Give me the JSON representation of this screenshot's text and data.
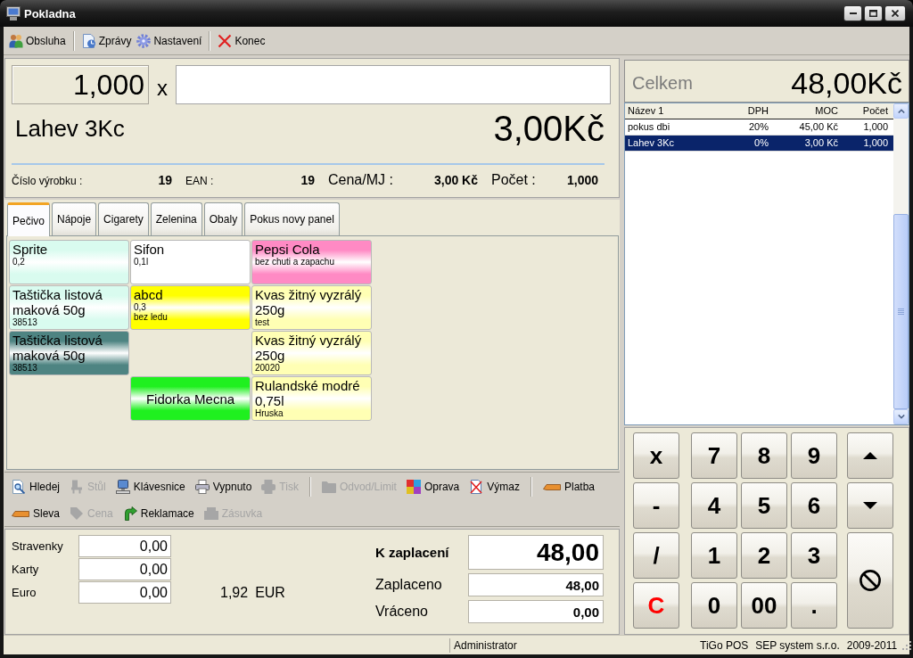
{
  "window": {
    "title": "Pokladna"
  },
  "toolbar": {
    "groups": [
      {
        "items": [
          {
            "label": "Obsluha"
          }
        ]
      },
      {
        "items": [
          {
            "label": "Zprávy"
          },
          {
            "label": "Nastavení"
          }
        ]
      },
      {
        "items": [
          {
            "label": "Konec"
          }
        ]
      }
    ]
  },
  "entry": {
    "quantity": "1,000",
    "times": "x"
  },
  "product": {
    "name": "Lahev 3Kc",
    "price": "3,00Kč",
    "details": [
      {
        "kind": "minor",
        "label": "Číslo výrobku :",
        "value": "19"
      },
      {
        "kind": "minor",
        "label": "EAN :",
        "value": "19"
      },
      {
        "kind": "major",
        "label": "Cena/MJ :",
        "value": "3,00 Kč"
      },
      {
        "kind": "major",
        "label": "Počet :",
        "value": "1,000"
      }
    ]
  },
  "tabs": [
    {
      "label": "Pečivo",
      "selected": true
    },
    {
      "label": "Nápoje",
      "selected": false
    },
    {
      "label": "Cigarety",
      "selected": false
    },
    {
      "label": "Zelenina",
      "selected": false
    },
    {
      "label": "Obaly",
      "selected": false
    },
    {
      "label": "Pokus novy panel",
      "selected": false
    }
  ],
  "tiles": {
    "rows": [
      {
        "cells": [
          {
            "kind": "product",
            "name": "Sprite",
            "notes": [
              "0,2"
            ],
            "color": "#d9fbef"
          },
          {
            "kind": "product",
            "name": "Sifon",
            "notes": [
              "0,1l"
            ],
            "color": "#ffffff"
          },
          {
            "kind": "product",
            "name": "Pepsi Cola",
            "notes": [
              "bez chuti a zapachu"
            ],
            "color": "#ff8ac4"
          }
        ]
      },
      {
        "cells": [
          {
            "kind": "product",
            "name": "Taštička listová maková 50g",
            "notes": [
              "38513"
            ],
            "color": "#d9fbef"
          },
          {
            "kind": "product",
            "name": "abcd",
            "notes": [
              "0,3",
              "bez ledu"
            ],
            "color": "#ffff00"
          },
          {
            "kind": "product",
            "name": "Kvas žitný vyzrálý 250g",
            "notes": [
              "test"
            ],
            "color": "#ffffb4"
          }
        ]
      },
      {
        "cells": [
          {
            "kind": "product",
            "name": "Taštička listová maková 50g",
            "notes": [
              "38513"
            ],
            "color": "#4e8482"
          },
          {
            "kind": "empty"
          },
          {
            "kind": "product",
            "name": "Kvas žitný vyzrálý 250g",
            "notes": [
              "20020"
            ],
            "color": "#ffffb4"
          }
        ]
      },
      {
        "cells": [
          {
            "kind": "empty"
          },
          {
            "kind": "product",
            "name": "Fidorka Mecna",
            "color": "#1ff01f"
          },
          {
            "kind": "product",
            "name": "Rulandské modré 0,75l",
            "notes": [
              "Hruska"
            ],
            "color": "#ffffb4"
          }
        ]
      }
    ]
  },
  "action_bar": {
    "rows": [
      {
        "groups": [
          {
            "items": [
              {
                "label": "Hledej",
                "disabled": false
              },
              {
                "label": "Stůl",
                "disabled": true
              },
              {
                "label": "Klávesnice",
                "disabled": false
              },
              {
                "label": "Vypnuto",
                "disabled": false
              },
              {
                "label": "Tisk",
                "disabled": true
              }
            ]
          },
          {
            "items": [
              {
                "label": "Odvod/Limit",
                "disabled": true
              },
              {
                "label": "Oprava",
                "disabled": false
              },
              {
                "label": "Výmaz",
                "disabled": false
              }
            ]
          },
          {
            "items": [
              {
                "label": "Platba",
                "disabled": false
              }
            ]
          }
        ]
      },
      {
        "groups": [
          {
            "items": [
              {
                "label": "Sleva",
                "disabled": false
              },
              {
                "label": "Cena",
                "disabled": true
              },
              {
                "label": "Reklamace",
                "disabled": false
              },
              {
                "label": "Zásuvka",
                "disabled": true
              }
            ]
          }
        ]
      }
    ]
  },
  "payment": {
    "tenders": [
      {
        "label": "Stravenky",
        "value": "0,00"
      },
      {
        "label": "Karty",
        "value": "0,00"
      },
      {
        "label": "Euro",
        "value": "0,00"
      }
    ],
    "conversion": {
      "amount": "1,92",
      "currency": "EUR"
    },
    "totals": [
      {
        "kind": "major",
        "label": "K zaplacení",
        "value": "48,00"
      },
      {
        "kind": "minor",
        "label": "Zaplaceno",
        "value": "48,00"
      },
      {
        "kind": "minor",
        "label": "Vráceno",
        "value": "0,00"
      }
    ]
  },
  "total": {
    "label": "Celkem",
    "amount": "48,00Kč"
  },
  "receipt": {
    "columns": [
      "Název 1",
      "DPH",
      "MOC",
      "Počet"
    ],
    "rows": [
      {
        "cells": [
          "pokus dbi",
          "20%",
          "45,00 Kč",
          "1,000"
        ],
        "selected": false
      },
      {
        "cells": [
          "Lahev 3Kc",
          "0%",
          "3,00 Kč",
          "1,000"
        ],
        "selected": true
      }
    ]
  },
  "keypad": {
    "keys": [
      {
        "kind": "key",
        "label": "x"
      },
      {
        "kind": "key",
        "label": "7"
      },
      {
        "kind": "key",
        "label": "8"
      },
      {
        "kind": "key",
        "label": "9"
      },
      {
        "kind": "up"
      },
      {
        "kind": "key",
        "label": "-"
      },
      {
        "kind": "key",
        "label": "4"
      },
      {
        "kind": "key",
        "label": "5"
      },
      {
        "kind": "key",
        "label": "6"
      },
      {
        "kind": "down"
      },
      {
        "kind": "key",
        "label": "/"
      },
      {
        "kind": "key",
        "label": "1"
      },
      {
        "kind": "key",
        "label": "2"
      },
      {
        "kind": "key",
        "label": "3"
      },
      {
        "kind": "cancel"
      },
      {
        "kind": "clear",
        "label": "C"
      },
      {
        "kind": "key",
        "label": "0"
      },
      {
        "kind": "key",
        "label": "00"
      },
      {
        "kind": "key",
        "label": "."
      }
    ]
  },
  "status_bar": {
    "user": "Administrator",
    "credits": [
      "TiGo POS",
      "SEP system s.r.o.",
      "2009-2011"
    ]
  }
}
